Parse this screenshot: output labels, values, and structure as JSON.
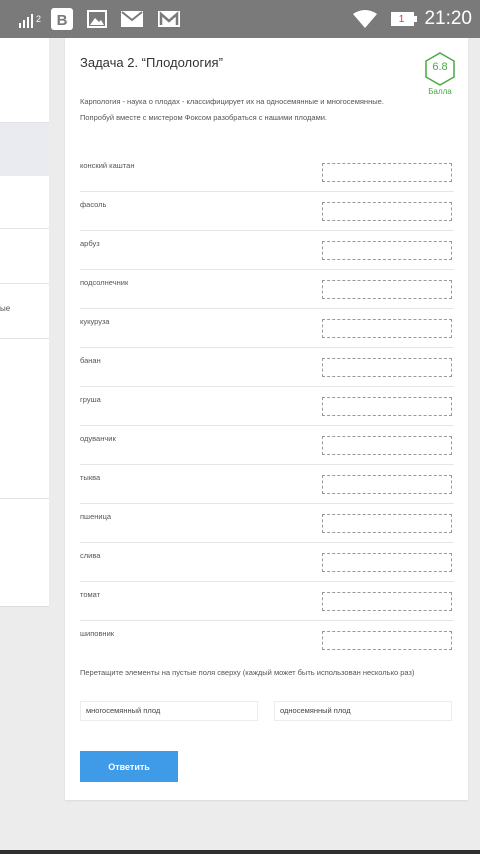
{
  "statusbar": {
    "network_label": "2",
    "notification_count": "1",
    "time": "21:20"
  },
  "sidebar": {
    "partial_text": "ые"
  },
  "task": {
    "title": "Задача 2. “Плодология”",
    "score_value": "6.8",
    "score_label": "Балла",
    "description_line1": "Карпология - наука о плодах - классифицирует их на односемянные и многосемянные.",
    "description_line2": "Попробуй вместе с мистером Фоксом разобраться с нашими плодами.",
    "items": [
      {
        "label": "конский каштан"
      },
      {
        "label": "фасоль"
      },
      {
        "label": "арбуз"
      },
      {
        "label": "подсолнечник"
      },
      {
        "label": "кукуруза"
      },
      {
        "label": "банан"
      },
      {
        "label": "груша"
      },
      {
        "label": "одуванчик"
      },
      {
        "label": "тыква"
      },
      {
        "label": "пшеница"
      },
      {
        "label": "слива"
      },
      {
        "label": "томат"
      },
      {
        "label": "шиповник"
      }
    ],
    "instruction": "Перетащите элементы на пустые поля сверху (каждый может быть использован несколько раз)",
    "options": [
      {
        "label": "многосемянный плод"
      },
      {
        "label": "односемянный плод"
      }
    ],
    "submit_label": "Ответить"
  },
  "colors": {
    "accent": "#3f9be8",
    "score": "#4aa843",
    "statusbar": "#7a7a7a"
  }
}
